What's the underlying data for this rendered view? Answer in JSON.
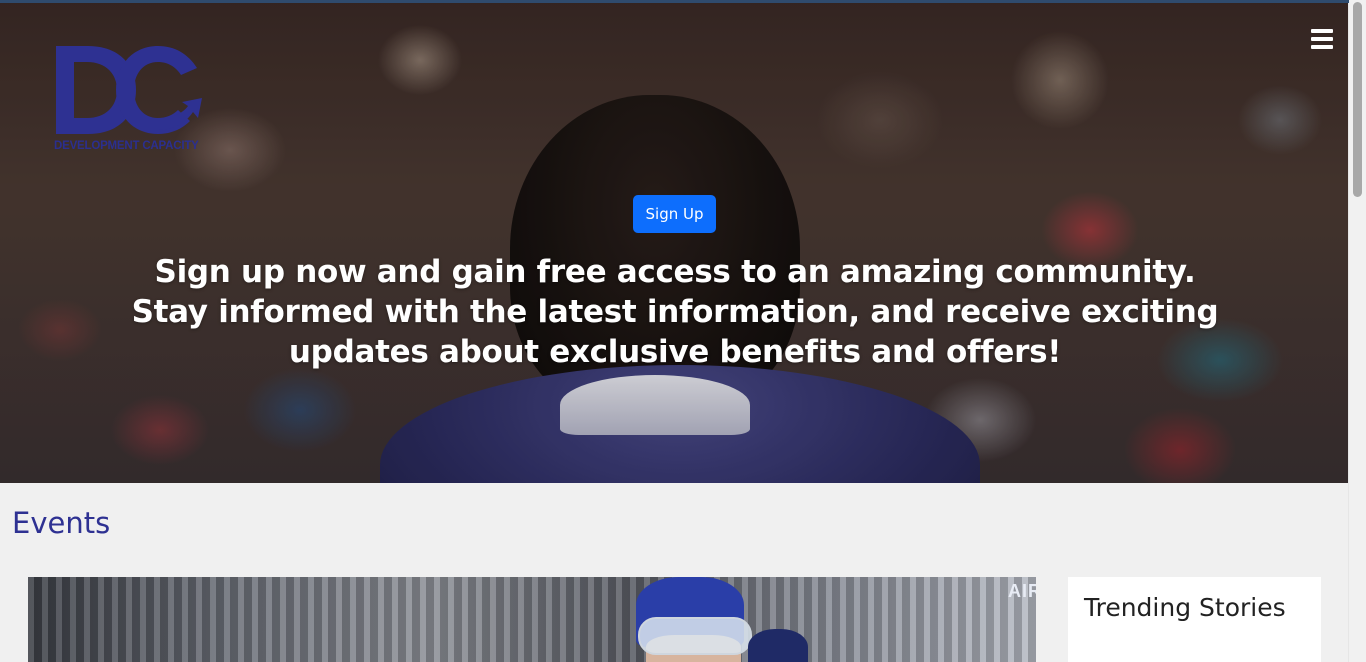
{
  "brand": {
    "logo_letters": "DC",
    "logo_text": "DEVELOPMENT CAPACITY",
    "logo_color": "#2e3192"
  },
  "header": {
    "menu_icon": "hamburger-menu-icon"
  },
  "hero": {
    "signup_label": "Sign Up",
    "headline": "Sign up now and gain free access to an amazing community. Stay informed with the latest information, and receive exciting updates about exclusive benefits and offers!",
    "button_color": "#0d6efd"
  },
  "events": {
    "heading": "Events",
    "image_sign_text": "AIRE"
  },
  "sidebar": {
    "trending_title": "Trending Stories"
  }
}
